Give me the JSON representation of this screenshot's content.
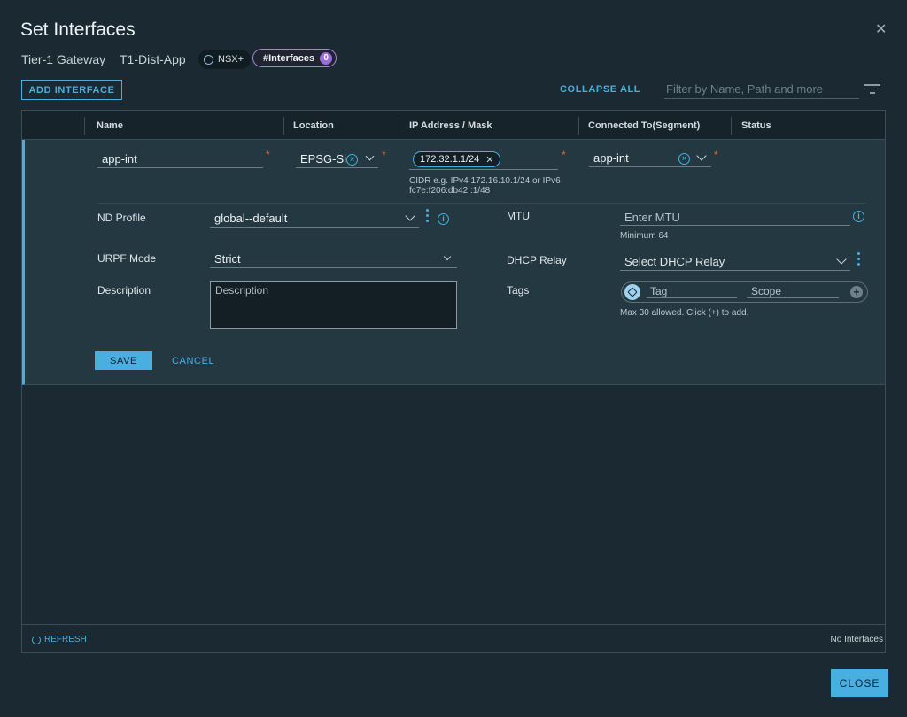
{
  "dialog": {
    "title": "Set Interfaces",
    "gateway_type": "Tier-1 Gateway",
    "gateway_name": "T1-Dist-App",
    "nsx_badge": "NSX+",
    "interfaces_badge": "#Interfaces",
    "interfaces_count": "0"
  },
  "toolbar": {
    "add_interface": "ADD INTERFACE",
    "collapse_all": "COLLAPSE ALL",
    "filter_placeholder": "Filter by Name, Path and more"
  },
  "columns": [
    "Name",
    "Location",
    "IP Address / Mask",
    "Connected To(Segment)",
    "Status"
  ],
  "form": {
    "name": "app-int",
    "location": "EPSG-Si",
    "ip_address": "172.32.1.1/24",
    "ip_hint_1": "CIDR e.g. IPv4 172.16.10.1/24 or IPv6",
    "ip_hint_2": "fc7e:f206:db42::1/48",
    "segment": "app-int",
    "nd_profile_label": "ND Profile",
    "nd_profile": "global--default",
    "mtu_label": "MTU",
    "mtu_placeholder": "Enter MTU",
    "mtu_hint": "Minimum 64",
    "urpf_label": "URPF Mode",
    "urpf": "Strict",
    "dhcp_label": "DHCP Relay",
    "dhcp_placeholder": "Select DHCP Relay",
    "description_label": "Description",
    "description_placeholder": "Description",
    "tags_label": "Tags",
    "tag_placeholder": "Tag",
    "scope_placeholder": "Scope",
    "tags_hint": "Max 30 allowed. Click (+) to add.",
    "save": "SAVE",
    "cancel": "CANCEL"
  },
  "footer": {
    "refresh": "REFRESH",
    "status": "No Interfaces",
    "close": "CLOSE"
  }
}
